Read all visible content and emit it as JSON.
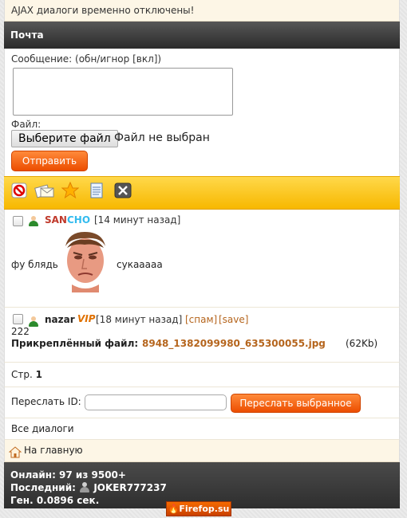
{
  "notice": "AJAX диалоги временно отключены!",
  "section_title": "Почта",
  "form": {
    "message_label": "Сообщение: (обн/игнор [вкл])",
    "message_value": "",
    "file_label": "Файл:",
    "file_button": "Выберите файл",
    "file_status": "Файл не выбран",
    "send_button": "Отправить"
  },
  "toolbar": {
    "icons": [
      "block-icon",
      "envelopes-icon",
      "star-icon",
      "notepad-icon",
      "delete-icon"
    ]
  },
  "posts": [
    {
      "user_part1": "SAN",
      "user_part2": "CHO",
      "time": "[14 минут назад]",
      "text_left": "фу блядь",
      "text_right": "сукааааа"
    },
    {
      "user": "nazar",
      "badge": "VIP",
      "time": "[18 минут назад]",
      "action_spam": "[спам]",
      "action_save": "[save]",
      "body": "222",
      "attach_label": "Прикреплённый файл:",
      "attach_name": "8948_1382099980_635300055.jpg",
      "attach_size": "(62Kb)"
    }
  ],
  "pager": {
    "label": "Стр.",
    "page": "1"
  },
  "forward": {
    "label": "Переслать ID:",
    "input_value": "",
    "button": "Переслать выбранное"
  },
  "all_dialogs": "Все диалоги",
  "home_link": "На главную",
  "footer": {
    "online": "Онлайн: 97 из 9500+",
    "last_label": "Последний:",
    "last_user": "JOKER777237",
    "gen": "Ген. 0.0896 сек."
  },
  "counter_badge": "Firefop.su",
  "colors": {
    "accent": "#f05a00",
    "toolbar": "#fcc820",
    "header": "#3a3a3a"
  }
}
